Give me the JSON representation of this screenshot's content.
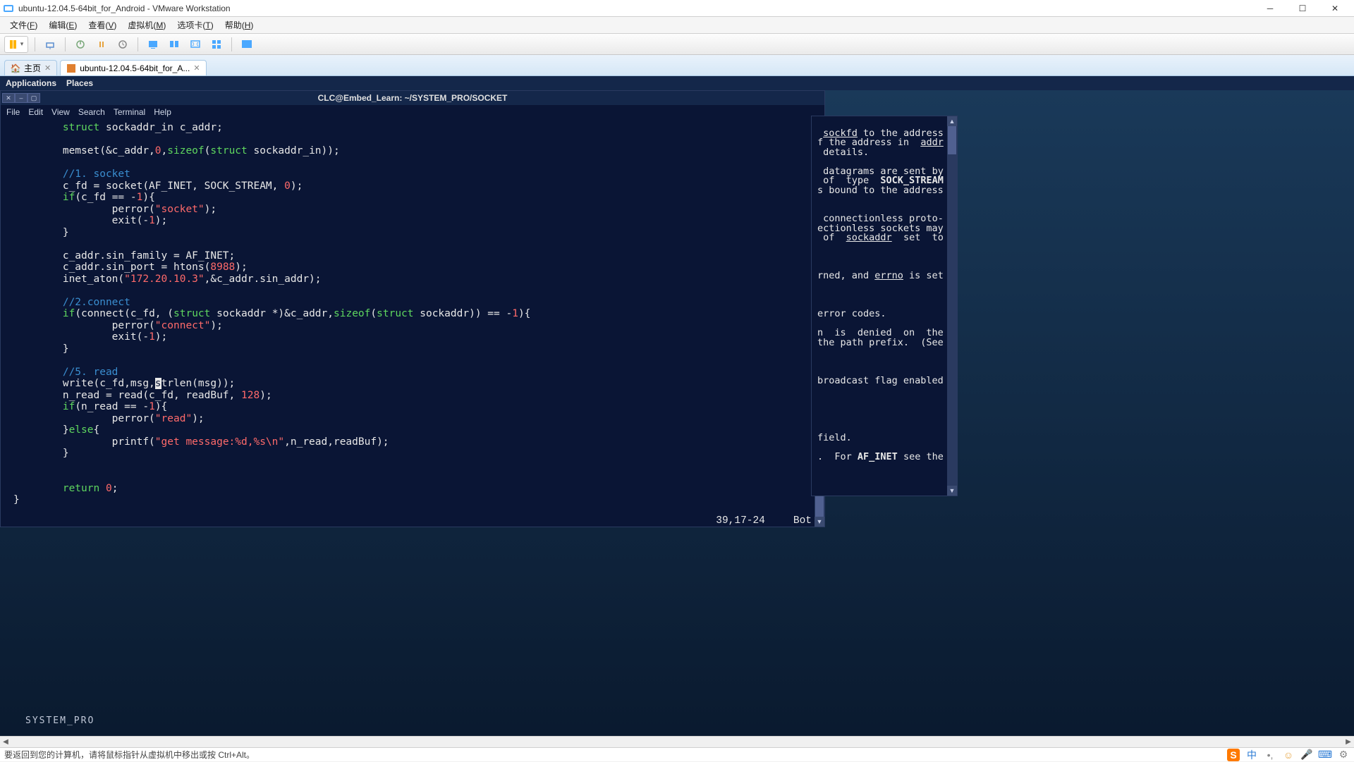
{
  "window": {
    "title": "ubuntu-12.04.5-64bit_for_Android - VMware Workstation"
  },
  "menubar": {
    "items": [
      {
        "label": "文件",
        "key": "F"
      },
      {
        "label": "编辑",
        "key": "E"
      },
      {
        "label": "查看",
        "key": "V"
      },
      {
        "label": "虚拟机",
        "key": "M"
      },
      {
        "label": "选项卡",
        "key": "T"
      },
      {
        "label": "帮助",
        "key": "H"
      }
    ]
  },
  "tabs": {
    "home": "主页",
    "vm": "ubuntu-12.04.5-64bit_for_A..."
  },
  "gnome_panel": {
    "apps": "Applications",
    "places": "Places"
  },
  "terminal": {
    "title": "CLC@Embed_Learn: ~/SYSTEM_PRO/SOCKET",
    "menu": [
      "File",
      "Edit",
      "View",
      "Search",
      "Terminal",
      "Help"
    ]
  },
  "code": {
    "lines": [
      [
        "        ",
        {
          "t": "struct",
          "c": "kw"
        },
        " sockaddr_in c_addr;"
      ],
      [
        ""
      ],
      [
        "        memset(&c_addr,",
        {
          "t": "0",
          "c": "num"
        },
        ",",
        {
          "t": "sizeof",
          "c": "kw"
        },
        "(",
        {
          "t": "struct",
          "c": "kw"
        },
        " sockaddr_in));"
      ],
      [
        ""
      ],
      [
        "        ",
        {
          "t": "//1. socket",
          "c": "cmt"
        }
      ],
      [
        "        c_fd = socket(AF_INET, SOCK_STREAM, ",
        {
          "t": "0",
          "c": "num"
        },
        ");"
      ],
      [
        "        ",
        {
          "t": "if",
          "c": "kw"
        },
        "(c_fd == -",
        {
          "t": "1",
          "c": "num"
        },
        "){"
      ],
      [
        "                perror(",
        {
          "t": "\"socket\"",
          "c": "str"
        },
        ");"
      ],
      [
        "                exit(-",
        {
          "t": "1",
          "c": "num"
        },
        ");"
      ],
      [
        "        }"
      ],
      [
        ""
      ],
      [
        "        c_addr.sin_family = AF_INET;"
      ],
      [
        "        c_addr.sin_port = htons(",
        {
          "t": "8988",
          "c": "num"
        },
        ");"
      ],
      [
        "        inet_aton(",
        {
          "t": "\"172.20.10.3\"",
          "c": "str"
        },
        ",&c_addr.sin_addr);"
      ],
      [
        ""
      ],
      [
        "        ",
        {
          "t": "//2.connect",
          "c": "cmt"
        }
      ],
      [
        "        ",
        {
          "t": "if",
          "c": "kw"
        },
        "(connect(c_fd, (",
        {
          "t": "struct",
          "c": "kw"
        },
        " sockaddr *)&c_addr,",
        {
          "t": "sizeof",
          "c": "kw"
        },
        "(",
        {
          "t": "struct",
          "c": "kw"
        },
        " sockaddr)) == -",
        {
          "t": "1",
          "c": "num"
        },
        "){"
      ],
      [
        "                perror(",
        {
          "t": "\"connect\"",
          "c": "str"
        },
        ");"
      ],
      [
        "                exit(-",
        {
          "t": "1",
          "c": "num"
        },
        ");"
      ],
      [
        "        }"
      ],
      [
        ""
      ],
      [
        "        ",
        {
          "t": "//5. read",
          "c": "cmt"
        }
      ],
      [
        "        write(c_fd,msg,",
        {
          "t": "s",
          "c": "cursor"
        },
        "trlen(msg));"
      ],
      [
        "        n_read = read(c_fd, readBuf, ",
        {
          "t": "128",
          "c": "num"
        },
        ");"
      ],
      [
        "        ",
        {
          "t": "if",
          "c": "kw"
        },
        "(n_read == -",
        {
          "t": "1",
          "c": "num"
        },
        "){"
      ],
      [
        "                perror(",
        {
          "t": "\"read\"",
          "c": "str"
        },
        ");"
      ],
      [
        "        }",
        {
          "t": "else",
          "c": "kw"
        },
        "{"
      ],
      [
        "                printf(",
        {
          "t": "\"get message:%d,%s\\n\"",
          "c": "str"
        },
        ",n_read,readBuf);"
      ],
      [
        "        }"
      ],
      [
        ""
      ],
      [
        ""
      ],
      [
        "        ",
        {
          "t": "return",
          "c": "kw"
        },
        " ",
        {
          "t": "0",
          "c": "num"
        },
        ";"
      ],
      [
        "}"
      ]
    ],
    "vim_pos": "39,17-24",
    "vim_pct": "Bot"
  },
  "man_panel": {
    "lines": [
      "",
      " <u>sockfd</u> to the address",
      "f the address in  <u>addr</u>",
      " details.",
      "",
      " datagrams are sent by",
      " of  type  <b>SOCK_STREAM</b>",
      "s bound to the address",
      "",
      "",
      " connectionless proto-",
      "ectionless sockets may",
      " of  <u>sockaddr</u>  set  to",
      "",
      "",
      "",
      "rned, and <u>errno</u> is set",
      "",
      "",
      "",
      "error codes.",
      "",
      "n  is  denied  on  the",
      "the path prefix.  (See",
      "",
      "",
      "",
      "broadcast flag enabled",
      "",
      "",
      "",
      "",
      "",
      "field.",
      "",
      ".  For <b>AF_INET</b> see the"
    ]
  },
  "desktop": {
    "bottom_label": "SYSTEM_PRO"
  },
  "statusbar": {
    "hint": "要返回到您的计算机，请将鼠标指针从虚拟机中移出或按 Ctrl+Alt。"
  }
}
